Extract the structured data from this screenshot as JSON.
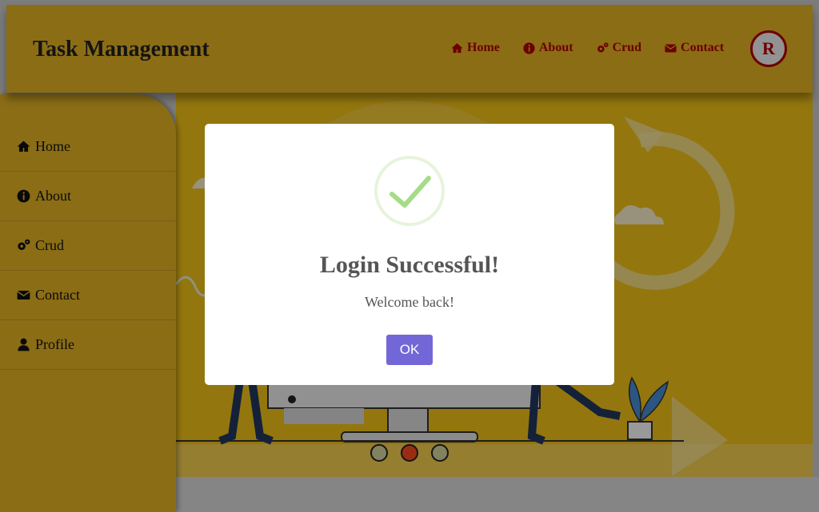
{
  "header": {
    "brand": "Task Management",
    "nav": [
      {
        "label": "Home",
        "icon": "home-icon"
      },
      {
        "label": "About",
        "icon": "info-icon"
      },
      {
        "label": "Crud",
        "icon": "gears-icon"
      },
      {
        "label": "Contact",
        "icon": "envelope-icon"
      }
    ],
    "avatar_letter": "R"
  },
  "sidebar": {
    "items": [
      {
        "label": "Home",
        "icon": "home-icon"
      },
      {
        "label": "About",
        "icon": "info-icon"
      },
      {
        "label": "Crud",
        "icon": "gears-icon"
      },
      {
        "label": "Contact",
        "icon": "envelope-icon"
      },
      {
        "label": "Profile",
        "icon": "user-icon"
      }
    ]
  },
  "carousel": {
    "slide_count": 3,
    "active_index": 1
  },
  "modal": {
    "title": "Login Successful!",
    "message": "Welcome back!",
    "ok_label": "OK"
  },
  "colors": {
    "header_bg": "#e8b626",
    "nav_text": "#b30000",
    "ok_button": "#7367d7",
    "success_check": "#a5dc86"
  }
}
